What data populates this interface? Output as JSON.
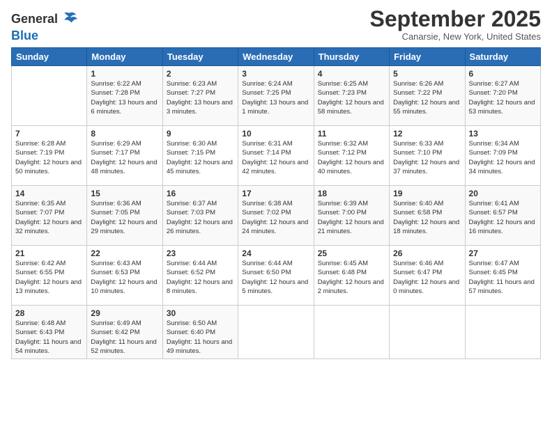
{
  "header": {
    "logo_general": "General",
    "logo_blue": "Blue",
    "month_title": "September 2025",
    "location": "Canarsie, New York, United States"
  },
  "weekdays": [
    "Sunday",
    "Monday",
    "Tuesday",
    "Wednesday",
    "Thursday",
    "Friday",
    "Saturday"
  ],
  "weeks": [
    [
      {
        "day": "",
        "sunrise": "",
        "sunset": "",
        "daylight": ""
      },
      {
        "day": "1",
        "sunrise": "Sunrise: 6:22 AM",
        "sunset": "Sunset: 7:28 PM",
        "daylight": "Daylight: 13 hours and 6 minutes."
      },
      {
        "day": "2",
        "sunrise": "Sunrise: 6:23 AM",
        "sunset": "Sunset: 7:27 PM",
        "daylight": "Daylight: 13 hours and 3 minutes."
      },
      {
        "day": "3",
        "sunrise": "Sunrise: 6:24 AM",
        "sunset": "Sunset: 7:25 PM",
        "daylight": "Daylight: 13 hours and 1 minute."
      },
      {
        "day": "4",
        "sunrise": "Sunrise: 6:25 AM",
        "sunset": "Sunset: 7:23 PM",
        "daylight": "Daylight: 12 hours and 58 minutes."
      },
      {
        "day": "5",
        "sunrise": "Sunrise: 6:26 AM",
        "sunset": "Sunset: 7:22 PM",
        "daylight": "Daylight: 12 hours and 55 minutes."
      },
      {
        "day": "6",
        "sunrise": "Sunrise: 6:27 AM",
        "sunset": "Sunset: 7:20 PM",
        "daylight": "Daylight: 12 hours and 53 minutes."
      }
    ],
    [
      {
        "day": "7",
        "sunrise": "Sunrise: 6:28 AM",
        "sunset": "Sunset: 7:19 PM",
        "daylight": "Daylight: 12 hours and 50 minutes."
      },
      {
        "day": "8",
        "sunrise": "Sunrise: 6:29 AM",
        "sunset": "Sunset: 7:17 PM",
        "daylight": "Daylight: 12 hours and 48 minutes."
      },
      {
        "day": "9",
        "sunrise": "Sunrise: 6:30 AM",
        "sunset": "Sunset: 7:15 PM",
        "daylight": "Daylight: 12 hours and 45 minutes."
      },
      {
        "day": "10",
        "sunrise": "Sunrise: 6:31 AM",
        "sunset": "Sunset: 7:14 PM",
        "daylight": "Daylight: 12 hours and 42 minutes."
      },
      {
        "day": "11",
        "sunrise": "Sunrise: 6:32 AM",
        "sunset": "Sunset: 7:12 PM",
        "daylight": "Daylight: 12 hours and 40 minutes."
      },
      {
        "day": "12",
        "sunrise": "Sunrise: 6:33 AM",
        "sunset": "Sunset: 7:10 PM",
        "daylight": "Daylight: 12 hours and 37 minutes."
      },
      {
        "day": "13",
        "sunrise": "Sunrise: 6:34 AM",
        "sunset": "Sunset: 7:09 PM",
        "daylight": "Daylight: 12 hours and 34 minutes."
      }
    ],
    [
      {
        "day": "14",
        "sunrise": "Sunrise: 6:35 AM",
        "sunset": "Sunset: 7:07 PM",
        "daylight": "Daylight: 12 hours and 32 minutes."
      },
      {
        "day": "15",
        "sunrise": "Sunrise: 6:36 AM",
        "sunset": "Sunset: 7:05 PM",
        "daylight": "Daylight: 12 hours and 29 minutes."
      },
      {
        "day": "16",
        "sunrise": "Sunrise: 6:37 AM",
        "sunset": "Sunset: 7:03 PM",
        "daylight": "Daylight: 12 hours and 26 minutes."
      },
      {
        "day": "17",
        "sunrise": "Sunrise: 6:38 AM",
        "sunset": "Sunset: 7:02 PM",
        "daylight": "Daylight: 12 hours and 24 minutes."
      },
      {
        "day": "18",
        "sunrise": "Sunrise: 6:39 AM",
        "sunset": "Sunset: 7:00 PM",
        "daylight": "Daylight: 12 hours and 21 minutes."
      },
      {
        "day": "19",
        "sunrise": "Sunrise: 6:40 AM",
        "sunset": "Sunset: 6:58 PM",
        "daylight": "Daylight: 12 hours and 18 minutes."
      },
      {
        "day": "20",
        "sunrise": "Sunrise: 6:41 AM",
        "sunset": "Sunset: 6:57 PM",
        "daylight": "Daylight: 12 hours and 16 minutes."
      }
    ],
    [
      {
        "day": "21",
        "sunrise": "Sunrise: 6:42 AM",
        "sunset": "Sunset: 6:55 PM",
        "daylight": "Daylight: 12 hours and 13 minutes."
      },
      {
        "day": "22",
        "sunrise": "Sunrise: 6:43 AM",
        "sunset": "Sunset: 6:53 PM",
        "daylight": "Daylight: 12 hours and 10 minutes."
      },
      {
        "day": "23",
        "sunrise": "Sunrise: 6:44 AM",
        "sunset": "Sunset: 6:52 PM",
        "daylight": "Daylight: 12 hours and 8 minutes."
      },
      {
        "day": "24",
        "sunrise": "Sunrise: 6:44 AM",
        "sunset": "Sunset: 6:50 PM",
        "daylight": "Daylight: 12 hours and 5 minutes."
      },
      {
        "day": "25",
        "sunrise": "Sunrise: 6:45 AM",
        "sunset": "Sunset: 6:48 PM",
        "daylight": "Daylight: 12 hours and 2 minutes."
      },
      {
        "day": "26",
        "sunrise": "Sunrise: 6:46 AM",
        "sunset": "Sunset: 6:47 PM",
        "daylight": "Daylight: 12 hours and 0 minutes."
      },
      {
        "day": "27",
        "sunrise": "Sunrise: 6:47 AM",
        "sunset": "Sunset: 6:45 PM",
        "daylight": "Daylight: 11 hours and 57 minutes."
      }
    ],
    [
      {
        "day": "28",
        "sunrise": "Sunrise: 6:48 AM",
        "sunset": "Sunset: 6:43 PM",
        "daylight": "Daylight: 11 hours and 54 minutes."
      },
      {
        "day": "29",
        "sunrise": "Sunrise: 6:49 AM",
        "sunset": "Sunset: 6:42 PM",
        "daylight": "Daylight: 11 hours and 52 minutes."
      },
      {
        "day": "30",
        "sunrise": "Sunrise: 6:50 AM",
        "sunset": "Sunset: 6:40 PM",
        "daylight": "Daylight: 11 hours and 49 minutes."
      },
      {
        "day": "",
        "sunrise": "",
        "sunset": "",
        "daylight": ""
      },
      {
        "day": "",
        "sunrise": "",
        "sunset": "",
        "daylight": ""
      },
      {
        "day": "",
        "sunrise": "",
        "sunset": "",
        "daylight": ""
      },
      {
        "day": "",
        "sunrise": "",
        "sunset": "",
        "daylight": ""
      }
    ]
  ]
}
